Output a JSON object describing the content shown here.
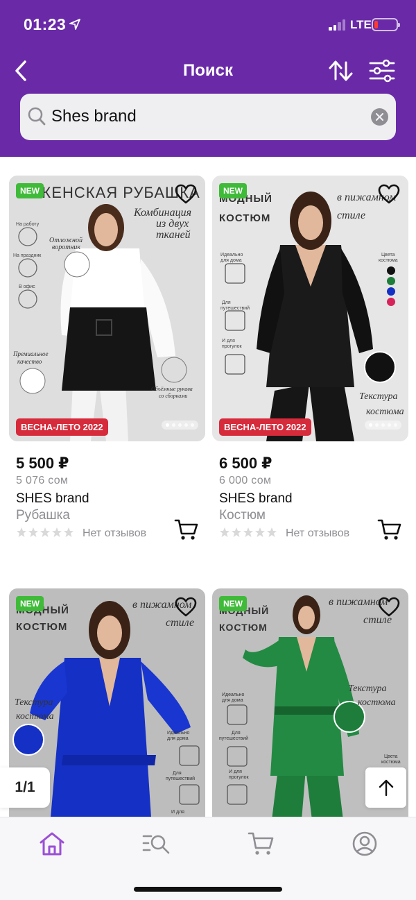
{
  "status_bar": {
    "time": "01:23",
    "network": "LTE"
  },
  "nav": {
    "title": "Поиск"
  },
  "search": {
    "value": "Shes brand"
  },
  "products": [
    {
      "badge": "NEW",
      "season_badge": "ВЕСНА-ЛЕТО 2022",
      "image_headline": "ЖЕНСКАЯ РУБАШКА",
      "price": "5 500 ₽",
      "price_alt": "5 076 сом",
      "brand": "SHES brand",
      "type": "Рубашка",
      "reviews": "Нет отзывов",
      "colors": {
        "bg": "#dcdcdc",
        "top": "#ffffff",
        "main": "#151515"
      }
    },
    {
      "badge": "NEW",
      "season_badge": "ВЕСНА-ЛЕТО 2022",
      "image_headline": "МОДНЫЙ КОСТЮМ",
      "price": "6 500 ₽",
      "price_alt": "6 000 сом",
      "brand": "SHES brand",
      "type": "Костюм",
      "reviews": "Нет отзывов",
      "colors": {
        "bg": "#e6e6e6",
        "main": "#161616"
      }
    },
    {
      "badge": "NEW",
      "image_headline": "МОДНЫЙ КОСТЮМ",
      "colors": {
        "bg": "#bdbdbd",
        "main": "#1530c4"
      }
    },
    {
      "badge": "NEW",
      "image_headline": "МОДНЫЙ КОСТЮМ",
      "colors": {
        "bg": "#bfbfbf",
        "main": "#1e7d3b"
      }
    }
  ],
  "pager": {
    "label": "1/1"
  },
  "theme": {
    "primary": "#6a2aa8",
    "new_badge": "#3fba39",
    "season_badge": "#d62b3b",
    "tab_active": "#9b4fd6"
  },
  "tabs": [
    {
      "icon": "home-icon",
      "active": true
    },
    {
      "icon": "catalog-search-icon",
      "active": false
    },
    {
      "icon": "cart-icon",
      "active": false
    },
    {
      "icon": "profile-icon",
      "active": false
    }
  ]
}
